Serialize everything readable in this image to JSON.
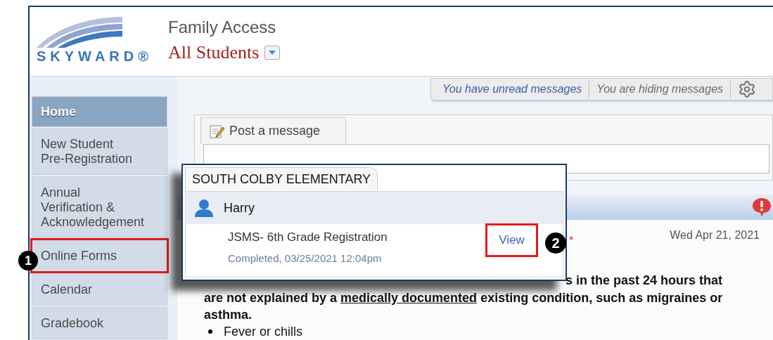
{
  "header": {
    "logo_text": "SKYWARD®",
    "app_title": "Family Access",
    "student_selector": "All Students"
  },
  "message_bar": {
    "items": [
      {
        "label": "You have unread messages",
        "kind": "unread"
      },
      {
        "label": "You are hiding messages",
        "kind": "hidden"
      }
    ]
  },
  "sidebar": {
    "items": [
      {
        "label": "Home",
        "selected": true,
        "highlighted": false
      },
      {
        "label_lines": [
          "New Student",
          "Pre-Registration"
        ],
        "selected": false,
        "highlighted": false
      },
      {
        "label_lines": [
          "Annual",
          "Verification &",
          "Acknowledgement"
        ],
        "selected": false,
        "highlighted": false
      },
      {
        "label": "Online Forms",
        "selected": false,
        "highlighted": true
      },
      {
        "label": "Calendar",
        "selected": false,
        "highlighted": false
      },
      {
        "label": "Gradebook",
        "selected": false,
        "highlighted": false
      }
    ]
  },
  "post_message": {
    "tab": "Post a message"
  },
  "message": {
    "date": "Wed Apr 21, 2021",
    "required_mark": "*",
    "line_fragment": "s in the past 24 hours that",
    "text_before": "are not explained by a ",
    "text_underlined": "medically documented",
    "text_after": " existing condition, such as migraines or asthma.",
    "bullets": [
      "Fever or chills"
    ]
  },
  "popup": {
    "school_tab": "SOUTH COLBY ELEMENTARY",
    "student": "Harry",
    "forms": [
      {
        "title": "JSMS- 6th Grade Registration",
        "status": "Completed, 03/25/2021 12:04pm",
        "action": "View",
        "action_highlighted": true
      }
    ]
  },
  "callouts": [
    {
      "number": "1"
    },
    {
      "number": "2"
    }
  ]
}
